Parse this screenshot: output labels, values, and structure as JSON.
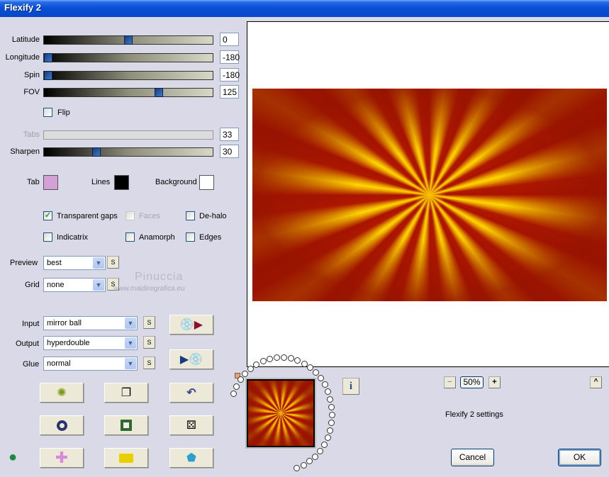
{
  "window": {
    "title": "Flexify 2"
  },
  "sliders": [
    {
      "label": "Latitude",
      "value": "0",
      "fraction": 0.5,
      "disabled": false
    },
    {
      "label": "Longitude",
      "value": "-180",
      "fraction": 0,
      "disabled": false
    },
    {
      "label": "Spin",
      "value": "-180",
      "fraction": 0,
      "disabled": false
    },
    {
      "label": "FOV",
      "value": "125",
      "fraction": 0.69,
      "disabled": false
    },
    {
      "label": "Tabs",
      "value": "33",
      "fraction": null,
      "disabled": true
    },
    {
      "label": "Sharpen",
      "value": "30",
      "fraction": 0.3,
      "disabled": false
    }
  ],
  "flip": {
    "label": "Flip",
    "checked": false
  },
  "colors": {
    "tab_label": "Tab",
    "tab": "#d4a0d8",
    "lines_label": "Lines",
    "lines": "#000000",
    "background_label": "Background",
    "background": "#ffffff"
  },
  "options": [
    {
      "label": "Transparent gaps",
      "checked": true,
      "disabled": false
    },
    {
      "label": "Faces",
      "checked": false,
      "disabled": true
    },
    {
      "label": "De-halo",
      "checked": false,
      "disabled": false
    },
    {
      "label": "Indicatrix",
      "checked": false,
      "disabled": false
    },
    {
      "label": "Anamorph",
      "checked": false,
      "disabled": false
    },
    {
      "label": "Edges",
      "checked": false,
      "disabled": false
    }
  ],
  "preview": {
    "label": "Preview",
    "value": "best"
  },
  "grid": {
    "label": "Grid",
    "value": "none"
  },
  "watermark": {
    "line1": "Pinuccia",
    "line2": "www.maidiregrafica.eu"
  },
  "input": {
    "label": "Input",
    "value": "mirror ball"
  },
  "output": {
    "label": "Output",
    "value": "hyperdouble"
  },
  "glue": {
    "label": "Glue",
    "value": "normal"
  },
  "s_label": "S",
  "zoom": {
    "minus": "−",
    "value": "50%",
    "plus": "+",
    "collapse": "^"
  },
  "info": "i",
  "status": "Flexify 2 settings",
  "buttons": {
    "cancel": "Cancel",
    "ok": "OK"
  }
}
